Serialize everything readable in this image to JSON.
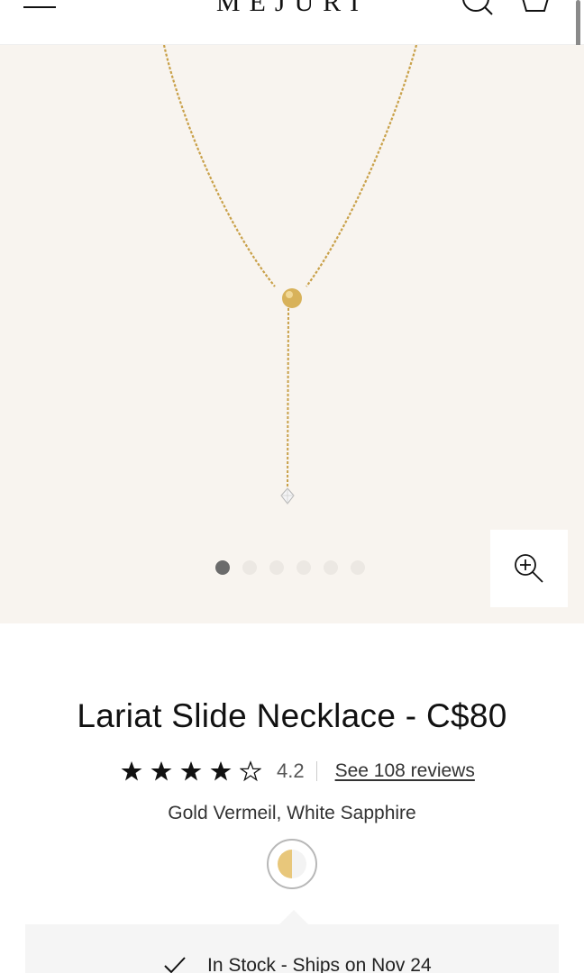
{
  "header": {
    "logo": "MEJURI",
    "menu_icon": "hamburger-menu-icon",
    "search_icon": "search-icon",
    "bag_icon": "shopping-bag-icon"
  },
  "gallery": {
    "image_count": 6,
    "active_index": 0,
    "zoom_icon": "zoom-in-icon",
    "background_color": "#f8f4ef"
  },
  "product": {
    "title": "Lariat Slide Necklace - C$80",
    "rating": {
      "value": "4.2",
      "stars_filled": 4,
      "stars_total": 5
    },
    "reviews_link": "See 108 reviews",
    "material": "Gold Vermeil, White Sapphire",
    "swatch": {
      "name": "gold-swatch",
      "color": "#e8c77b"
    }
  },
  "stock": {
    "icon": "checkmark-icon",
    "text": "In Stock - Ships on Nov 24"
  }
}
